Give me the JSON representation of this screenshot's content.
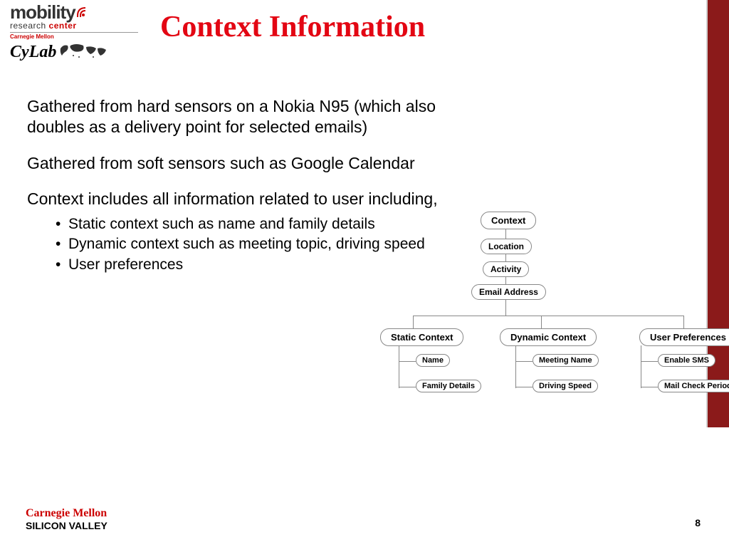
{
  "logos": {
    "mobility_word": "mobility",
    "mobility_sub_prefix": "research",
    "mobility_sub_suffix": "center",
    "cm_tiny": "Carnegie Mellon",
    "cylab": "CyLab"
  },
  "title": "Context Information",
  "paragraphs": {
    "p1": "Gathered from hard sensors on a Nokia N95 (which also doubles as a delivery point for selected emails)",
    "p2": "Gathered from soft sensors such as Google Calendar",
    "p3": "Context includes all information related to user including,"
  },
  "bullets": {
    "b1": "Static context such as name and family details",
    "b2": "Dynamic context such as meeting topic, driving speed",
    "b3": "User preferences"
  },
  "diagram": {
    "root": "Context",
    "mid": {
      "m1": "Location",
      "m2": "Activity",
      "m3": "Email Address"
    },
    "branches": {
      "left": {
        "label": "Static Context",
        "c1": "Name",
        "c2": "Family Details"
      },
      "center": {
        "label": "Dynamic Context",
        "c1": "Meeting Name",
        "c2": "Driving Speed"
      },
      "right": {
        "label": "User Preferences",
        "c1": "Enable SMS",
        "c2": "Mail Check Periodicity"
      }
    }
  },
  "footer": {
    "cm": "Carnegie Mellon",
    "sv": "SILICON VALLEY",
    "page": "8"
  }
}
